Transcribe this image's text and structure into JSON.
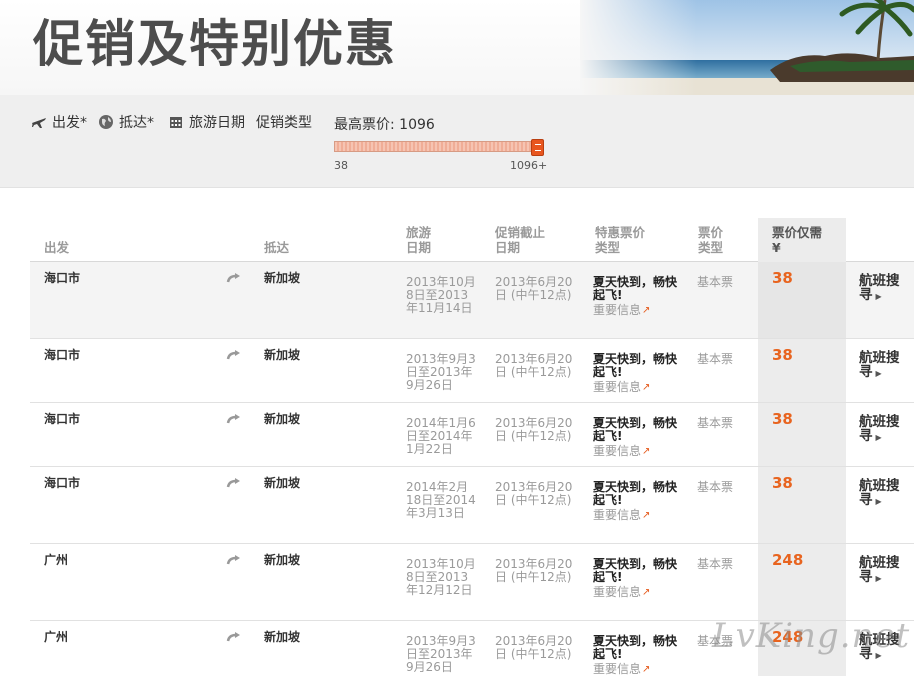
{
  "header": {
    "title": "促销及特别优惠"
  },
  "filters": {
    "departure_label": "出发*",
    "arrival_label": "抵达*",
    "travel_date_label": "旅游日期",
    "promo_type_label": "促销类型",
    "max_price_label": "最高票价: 1096",
    "slider_min": "38",
    "slider_max": "1096+",
    "slider_value": 1096,
    "slider_range_min": 38,
    "slider_range_max": 1096
  },
  "table": {
    "headers": {
      "departure": "出发",
      "arrival": "抵达",
      "travel_date": "旅游\n日期",
      "deadline": "促销截止\n日期",
      "promo_type": "特惠票价\n类型",
      "ticket_type": "票价\n类型",
      "price": "票价仅需\n¥"
    },
    "rows": [
      {
        "from": "海口市",
        "to": "新加坡",
        "travel": "2013年10月8日至2013年11月14日",
        "deadline": "2013年6月20日 (中午12点)",
        "promo_title": "夏天快到，畅快起飞!",
        "promo_info": "重要信息",
        "ticket_type": "基本票",
        "price": "38",
        "search": "航班搜寻"
      },
      {
        "from": "海口市",
        "to": "新加坡",
        "travel": "2013年9月3日至2013年9月26日",
        "deadline": "2013年6月20日 (中午12点)",
        "promo_title": "夏天快到，畅快起飞!",
        "promo_info": "重要信息",
        "ticket_type": "基本票",
        "price": "38",
        "search": "航班搜寻"
      },
      {
        "from": "海口市",
        "to": "新加坡",
        "travel": "2014年1月6日至2014年1月22日",
        "deadline": "2013年6月20日 (中午12点)",
        "promo_title": "夏天快到，畅快起飞!",
        "promo_info": "重要信息",
        "ticket_type": "基本票",
        "price": "38",
        "search": "航班搜寻"
      },
      {
        "from": "海口市",
        "to": "新加坡",
        "travel": "2014年2月18日至2014年3月13日",
        "deadline": "2013年6月20日 (中午12点)",
        "promo_title": "夏天快到，畅快起飞!",
        "promo_info": "重要信息",
        "ticket_type": "基本票",
        "price": "38",
        "search": "航班搜寻"
      },
      {
        "from": "广州",
        "to": "新加坡",
        "travel": "2013年10月8日至2013年12月12日",
        "deadline": "2013年6月20日 (中午12点)",
        "promo_title": "夏天快到，畅快起飞!",
        "promo_info": "重要信息",
        "ticket_type": "基本票",
        "price": "248",
        "search": "航班搜寻"
      },
      {
        "from": "广州",
        "to": "新加坡",
        "travel": "2013年9月3日至2013年9月26日",
        "deadline": "2013年6月20日 (中午12点)",
        "promo_title": "夏天快到，畅快起飞!",
        "promo_info": "重要信息",
        "ticket_type": "基本票",
        "price": "248",
        "search": "航班搜寻"
      }
    ]
  },
  "watermark": "LvKing.net",
  "colors": {
    "accent": "#e8641f",
    "muted_text": "#9a9a9a",
    "filter_bar": "#efefef"
  },
  "icons": {
    "departure": "plane-icon",
    "arrival": "globe-icon",
    "travel_date": "calendar-icon",
    "route": "route-arrow-icon",
    "external": "external-link-icon",
    "search": "triangle-right-icon"
  }
}
